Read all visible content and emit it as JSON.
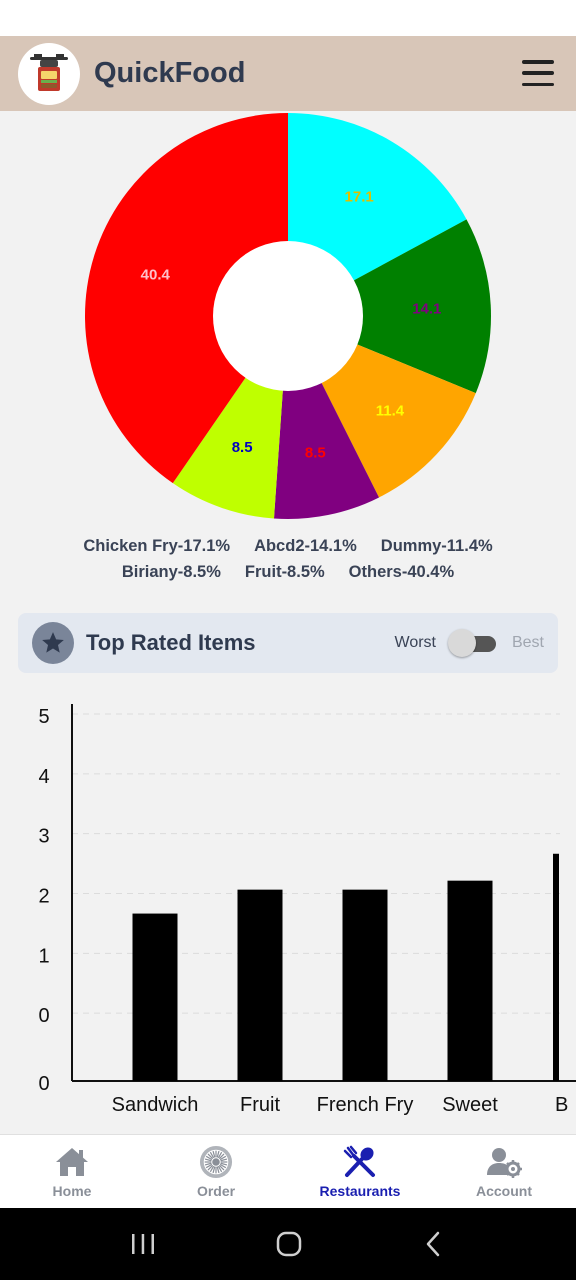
{
  "app": {
    "title": "QuickFood"
  },
  "pie": {
    "slices": [
      {
        "value": 17.1,
        "label": "17.1",
        "color": "#00ffff",
        "label_color": "#e0c000"
      },
      {
        "value": 14.1,
        "label": "14.1",
        "color": "#008000",
        "label_color": "#800080"
      },
      {
        "value": 11.4,
        "label": "11.4",
        "color": "#ffa500",
        "label_color": "#ffff00"
      },
      {
        "value": 8.5,
        "label": "8.5",
        "color": "#800080",
        "label_color": "#ff0000"
      },
      {
        "value": 8.5,
        "label": "8.5",
        "color": "#bfff00",
        "label_color": "#0000c0"
      },
      {
        "value": 40.4,
        "label": "40.4",
        "color": "#ff0000",
        "label_color": "#ffc0cb"
      }
    ]
  },
  "legend": {
    "row1": [
      "Chicken Fry-17.1%",
      "Abcd2-14.1%",
      "Dummy-11.4%"
    ],
    "row2": [
      "Biriany-8.5%",
      "Fruit-8.5%",
      "Others-40.4%"
    ]
  },
  "top_rated": {
    "title": "Top Rated Items",
    "worst_label": "Worst",
    "best_label": "Best",
    "toggle_on": false
  },
  "chart_data": {
    "type": "bar",
    "categories": [
      "Sandwich",
      "Fruit",
      "French Fry",
      "Sweet",
      "B"
    ],
    "values": [
      2.8,
      3.2,
      3.2,
      3.35,
      3.8
    ],
    "ytick_labels": [
      "0",
      "0",
      "1",
      "2",
      "3",
      "4",
      "5"
    ],
    "bar_color": "#000000",
    "grid": true
  },
  "nav": {
    "items": [
      {
        "label": "Home",
        "icon": "home-icon",
        "active": false
      },
      {
        "label": "Order",
        "icon": "order-icon",
        "active": false
      },
      {
        "label": "Restaurants",
        "icon": "restaurants-icon",
        "active": true
      },
      {
        "label": "Account",
        "icon": "account-settings-icon",
        "active": false
      }
    ],
    "active_color": "#1a1fb0",
    "inactive_color": "#8a8f98"
  }
}
